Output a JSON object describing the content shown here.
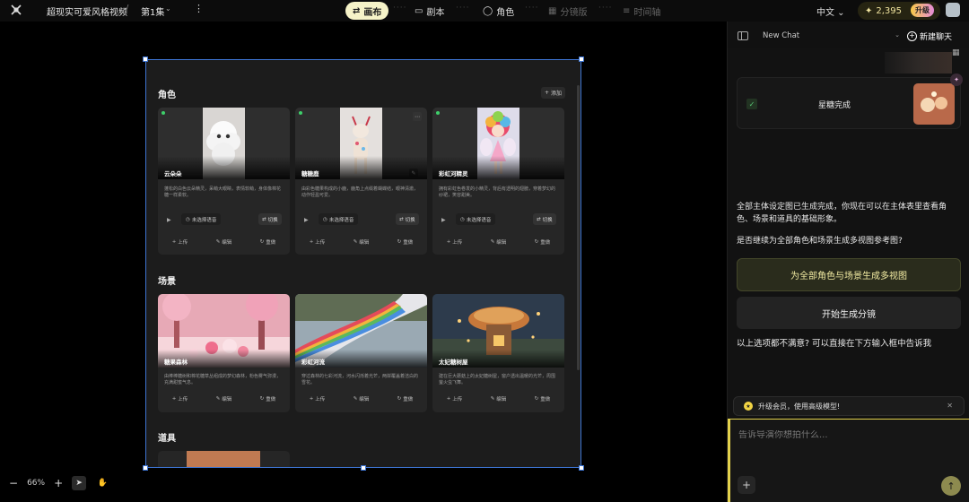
{
  "header": {
    "project_title": "超现实可爱风格视频",
    "separator": "/",
    "episode": "第1集",
    "tabs": [
      {
        "label": "画布",
        "icon": "sliders-icon",
        "state": "active"
      },
      {
        "label": "剧本",
        "icon": "chat-bubble-icon",
        "state": "normal"
      },
      {
        "label": "角色",
        "icon": "person-icon",
        "state": "normal"
      },
      {
        "label": "分镜版",
        "icon": "film-icon",
        "state": "disabled"
      },
      {
        "label": "时间轴",
        "icon": "timeline-icon",
        "state": "disabled"
      }
    ],
    "language": "中文",
    "credits": "2,395",
    "upgrade_label": "升级"
  },
  "canvas": {
    "frame_tag": "角色",
    "characters_title": "角色",
    "add_label": "添加",
    "characters": [
      {
        "name": "云朵朵",
        "desc": "蓬松的白色云朵精灵，呆萌大眼睛，表情软萌，身体像棉花糖一样柔软。",
        "voice": "未选择语音",
        "switch": "切换",
        "upload": "上传",
        "edit": "编辑",
        "regen": "重做"
      },
      {
        "name": "糖糖鹿",
        "desc": "由彩色糖果构成的小鹿，鹿角上点缀着蝴蝶结，眼神清澈，动作轻盈可爱。",
        "voice": "未选择语音",
        "switch": "切换",
        "upload": "上传",
        "edit": "编辑",
        "regen": "重做"
      },
      {
        "name": "彩虹河精灵",
        "desc": "拥有彩虹色卷发的小精灵，背后有透明的翅膀，穿着梦幻的纱裙，笑容甜美。",
        "voice": "未选择语音",
        "switch": "切换",
        "upload": "上传",
        "edit": "编辑",
        "regen": "重做"
      }
    ],
    "scenes_title": "场景",
    "scenes": [
      {
        "name": "糖果森林",
        "desc": "由棒棒糖树和棉花糖草丛组成的梦幻森林，粉色雾气弥漫，充满甜蜜气息。",
        "upload": "上传",
        "edit": "编辑",
        "regen": "重做"
      },
      {
        "name": "彩虹河流",
        "desc": "穿过森林的七彩河流，河水闪烁着光芒，两岸覆盖着洁白的雪花。",
        "upload": "上传",
        "edit": "编辑",
        "regen": "重做"
      },
      {
        "name": "太妃糖树屋",
        "desc": "建在巨大蘑菇上的太妃糖树屋，窗户透出温暖的光芒，周围萤火虫飞舞。",
        "upload": "上传",
        "edit": "编辑",
        "regen": "重做"
      }
    ],
    "props_title": "道具"
  },
  "zoom": {
    "minus": "−",
    "level": "66%",
    "plus": "+"
  },
  "chat": {
    "select_value": "New Chat",
    "new_chat_label": "新建聊天",
    "status": "星糖完成",
    "message1": "全部主体设定图已生成完成，你现在可以在主体表里查看角色、场景和道具的基础形象。",
    "message2": "是否继续为全部角色和场景生成多视图参考图?",
    "option1": "为全部角色与场景生成多视图",
    "option2": "开始生成分镜",
    "message3": "以上选项都不满意? 可以直接在下方输入框中告诉我",
    "promo": "升级会员，使用高级模型!",
    "placeholder": "告诉导演你想拍什么..."
  },
  "colors": {
    "accent": "#f6f3c8",
    "selection": "#3d74d1",
    "send": "#8d8a4f"
  }
}
